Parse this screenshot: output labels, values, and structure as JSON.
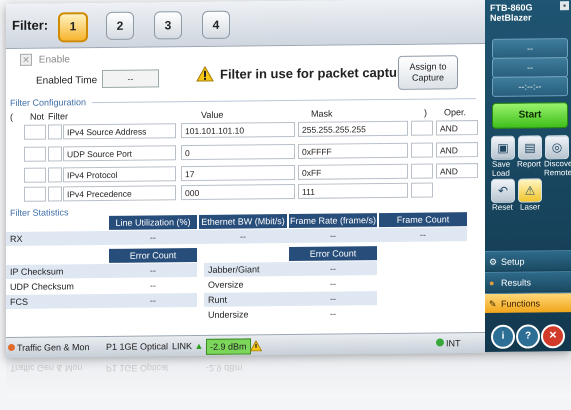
{
  "filter_bar": {
    "label": "Filter:",
    "tabs": [
      "1",
      "2",
      "3",
      "4"
    ],
    "active_tab": "1"
  },
  "enable": {
    "label": "Enable",
    "checked_mark": "✕"
  },
  "enabled_time": {
    "label": "Enabled Time",
    "value": "--"
  },
  "warning": {
    "text": "Filter in use for packet capture",
    "icon": "warning-triangle-icon"
  },
  "assign_button": {
    "line1": "Assign to",
    "line2": "Capture"
  },
  "filter_config": {
    "title": "Filter Configuration",
    "headers": {
      "open_paren": "(",
      "not": "Not",
      "filter": "Filter",
      "value": "Value",
      "mask": "Mask",
      "close_paren": ")",
      "oper": "Oper."
    },
    "rows": [
      {
        "filter": "IPv4 Source Address",
        "value": "101.101.101.10",
        "mask": "255.255.255.255",
        "oper": "AND"
      },
      {
        "filter": "UDP Source Port",
        "value": "0",
        "mask": "0xFFFF",
        "oper": "AND"
      },
      {
        "filter": "IPv4 Protocol",
        "value": "17",
        "mask": "0xFF",
        "oper": "AND"
      },
      {
        "filter": "IPv4 Precedence",
        "value": "000",
        "mask": "111",
        "oper": ""
      }
    ]
  },
  "filter_stats": {
    "title": "Filter Statistics",
    "headers": [
      "Line Utilization (%)",
      "Ethernet BW (Mbit/s)",
      "Frame Rate (frame/s)",
      "Frame Count"
    ],
    "rx": {
      "label": "RX",
      "values": [
        "--",
        "--",
        "--",
        "--"
      ]
    },
    "error_count_header": "Error Count",
    "left_errors": [
      {
        "label": "IP Checksum",
        "value": "--"
      },
      {
        "label": "UDP Checksum",
        "value": "--"
      },
      {
        "label": "FCS",
        "value": "--"
      }
    ],
    "right_errors": [
      {
        "label": "Jabber/Giant",
        "value": "--"
      },
      {
        "label": "Oversize",
        "value": "--"
      },
      {
        "label": "Runt",
        "value": "--"
      },
      {
        "label": "Undersize",
        "value": "--"
      }
    ]
  },
  "status_bar": {
    "app": "Traffic Gen & Mon",
    "port": "P1 1GE Optical",
    "link": "LINK",
    "power": "-2.9 dBm",
    "clock": "INT"
  },
  "side_panel": {
    "title_line1": "FTB-860G",
    "title_line2": "NetBlazer",
    "box1": "--",
    "box2": "--",
    "box3": "--:--:--",
    "start": "Start",
    "icons": [
      {
        "name": "save-load",
        "label1": "Save",
        "label2": "Load"
      },
      {
        "name": "report",
        "label1": "Report",
        "label2": ""
      },
      {
        "name": "discover-remote",
        "label1": "Discover",
        "label2": "Remote"
      },
      {
        "name": "reset",
        "label1": "Reset",
        "label2": ""
      },
      {
        "name": "laser",
        "label1": "Laser",
        "label2": ""
      }
    ],
    "menu": [
      "Setup",
      "Results",
      "Functions"
    ],
    "bottom_buttons": [
      "i",
      "?",
      "✕"
    ]
  },
  "colors": {
    "accent_orange": "#f6b52e",
    "table_header": "#274d7a",
    "side_bg": "#1f5572",
    "start_green": "#3fbf1a"
  }
}
